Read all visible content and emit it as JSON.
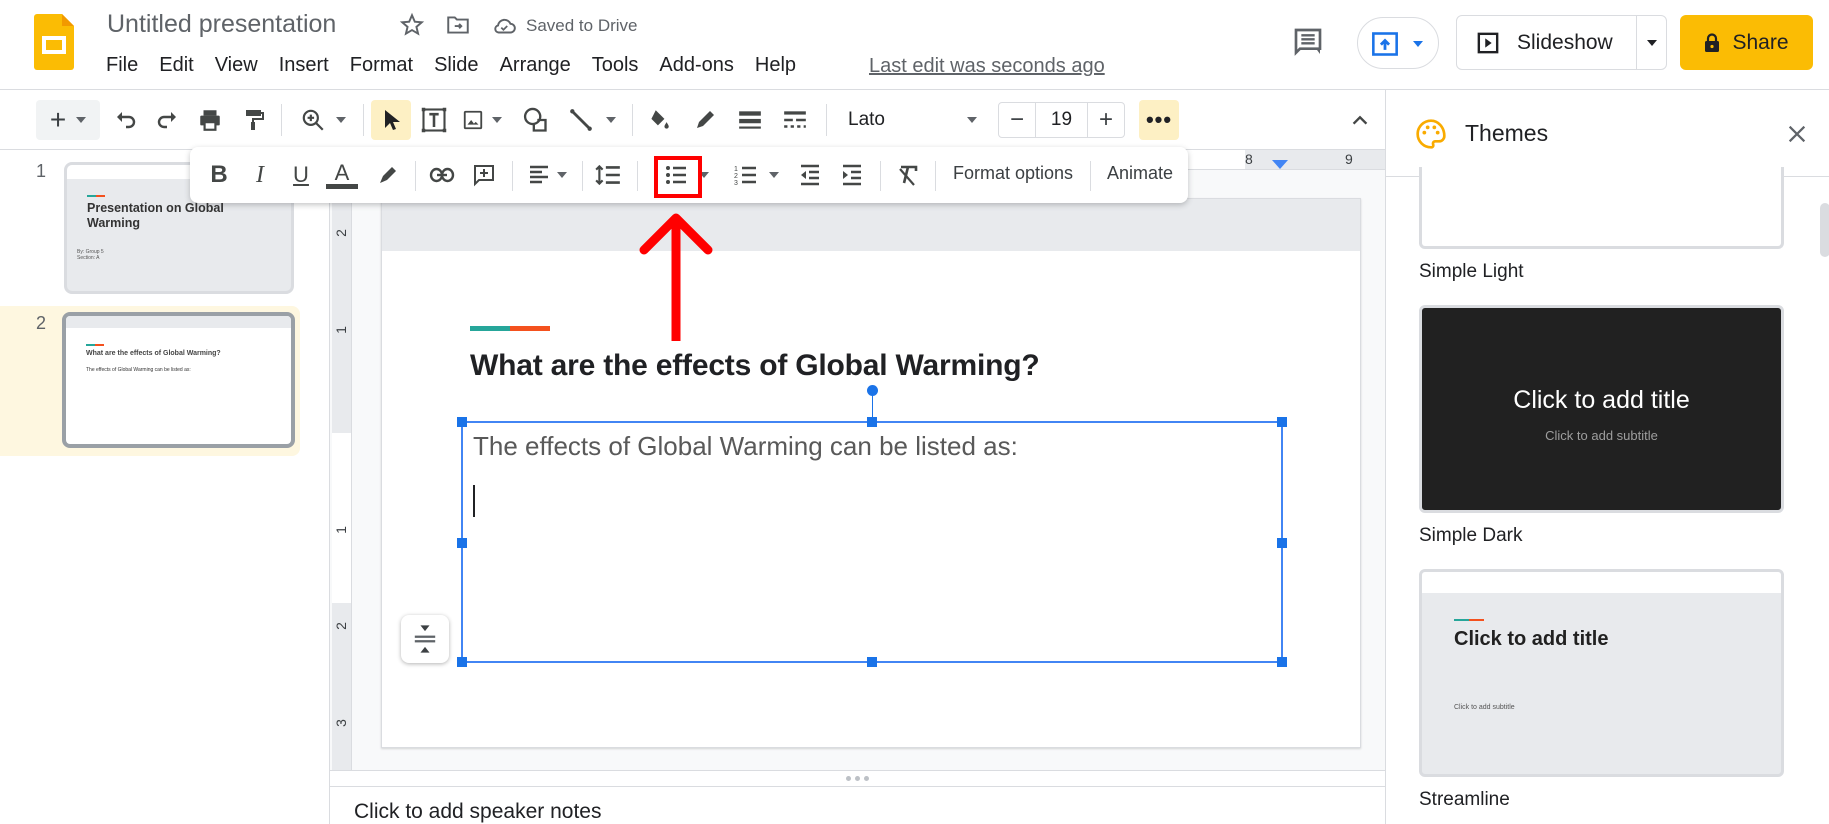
{
  "app": {
    "doc_title": "Untitled presentation",
    "save_status": "Saved to Drive",
    "last_edit": "Last edit was seconds ago",
    "menu": [
      "File",
      "Edit",
      "View",
      "Insert",
      "Format",
      "Slide",
      "Arrange",
      "Tools",
      "Add-ons",
      "Help"
    ],
    "slideshow_label": "Slideshow",
    "share_label": "Share",
    "accent_color": "#fbbc04"
  },
  "toolbar": {
    "font": "Lato",
    "font_size": "19",
    "more_label": "•••"
  },
  "format_toolbar": {
    "format_options_label": "Format options",
    "animate_label": "Animate",
    "highlighted_button": "bulleted-list"
  },
  "rulers": {
    "horizontal_labels": [
      "8",
      "9"
    ],
    "vertical_labels": [
      "2",
      "1",
      "1",
      "2",
      "3"
    ]
  },
  "filmstrip": {
    "slides": [
      {
        "number": "1",
        "title": "Presentation on Global Warming",
        "subtitle_line1": "By: Group 5",
        "subtitle_line2": "Section: A"
      },
      {
        "number": "2",
        "title": "What are the effects of Global Warming?",
        "body": "The effects of Global Warming can be listed as:",
        "selected": true
      }
    ]
  },
  "slide": {
    "title": "What are the effects of Global Warming?",
    "body": "The effects of Global Warming can be listed as:",
    "accent_colors": [
      "#26a69a",
      "#f4511e"
    ]
  },
  "notes": {
    "placeholder": "Click to add speaker notes"
  },
  "themes": {
    "title": "Themes",
    "items": [
      {
        "name": "Simple Light"
      },
      {
        "name": "Simple Dark",
        "preview_title": "Click to add title",
        "preview_subtitle": "Click to add subtitle"
      },
      {
        "name": "Streamline",
        "preview_title": "Click to add title",
        "preview_subtitle": "Click to add subtitle"
      }
    ]
  }
}
